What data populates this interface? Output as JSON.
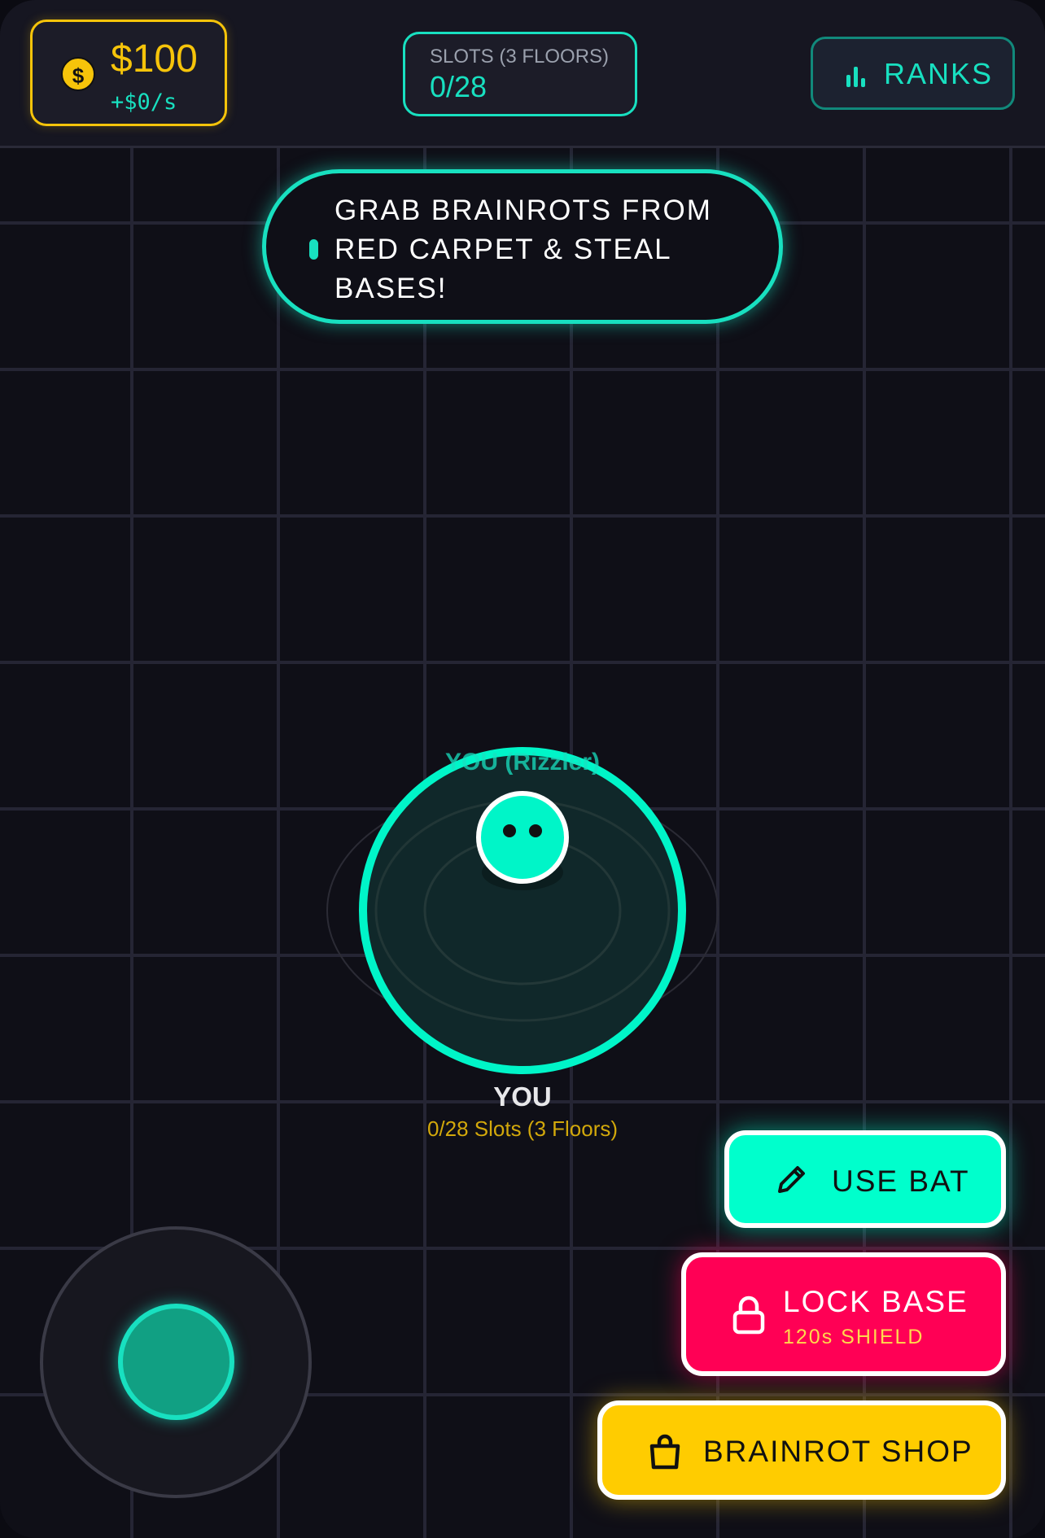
{
  "hud": {
    "money": "$100",
    "income_rate": "+$0/s",
    "slots_label": "SLOTS (3 FLOORS)",
    "slots_value": "0/28",
    "ranks_label": "RANKS"
  },
  "banner": {
    "text": "GRAB BRAINROTS FROM RED CARPET & STEAL BASES!"
  },
  "player": {
    "name_tag": "YOU (Rizzler)",
    "label": "YOU",
    "slots_status": "0/28 Slots (3 Floors)"
  },
  "actions": {
    "bat_label": "USE BAT",
    "lock_label": "LOCK BASE",
    "lock_sub": "120s SHIELD",
    "shop_label": "BRAINROT SHOP"
  },
  "icons": {
    "coin": "dollar-coin-icon",
    "ranks": "bar-chart-icon",
    "bat": "pencil-icon",
    "lock": "lock-icon",
    "shop": "shopping-bag-icon"
  },
  "colors": {
    "accent_teal": "#18e0c0",
    "gold": "#f6c40a",
    "red": "#ff0055",
    "yellow": "#ffcc00",
    "background": "#0f0f17"
  }
}
